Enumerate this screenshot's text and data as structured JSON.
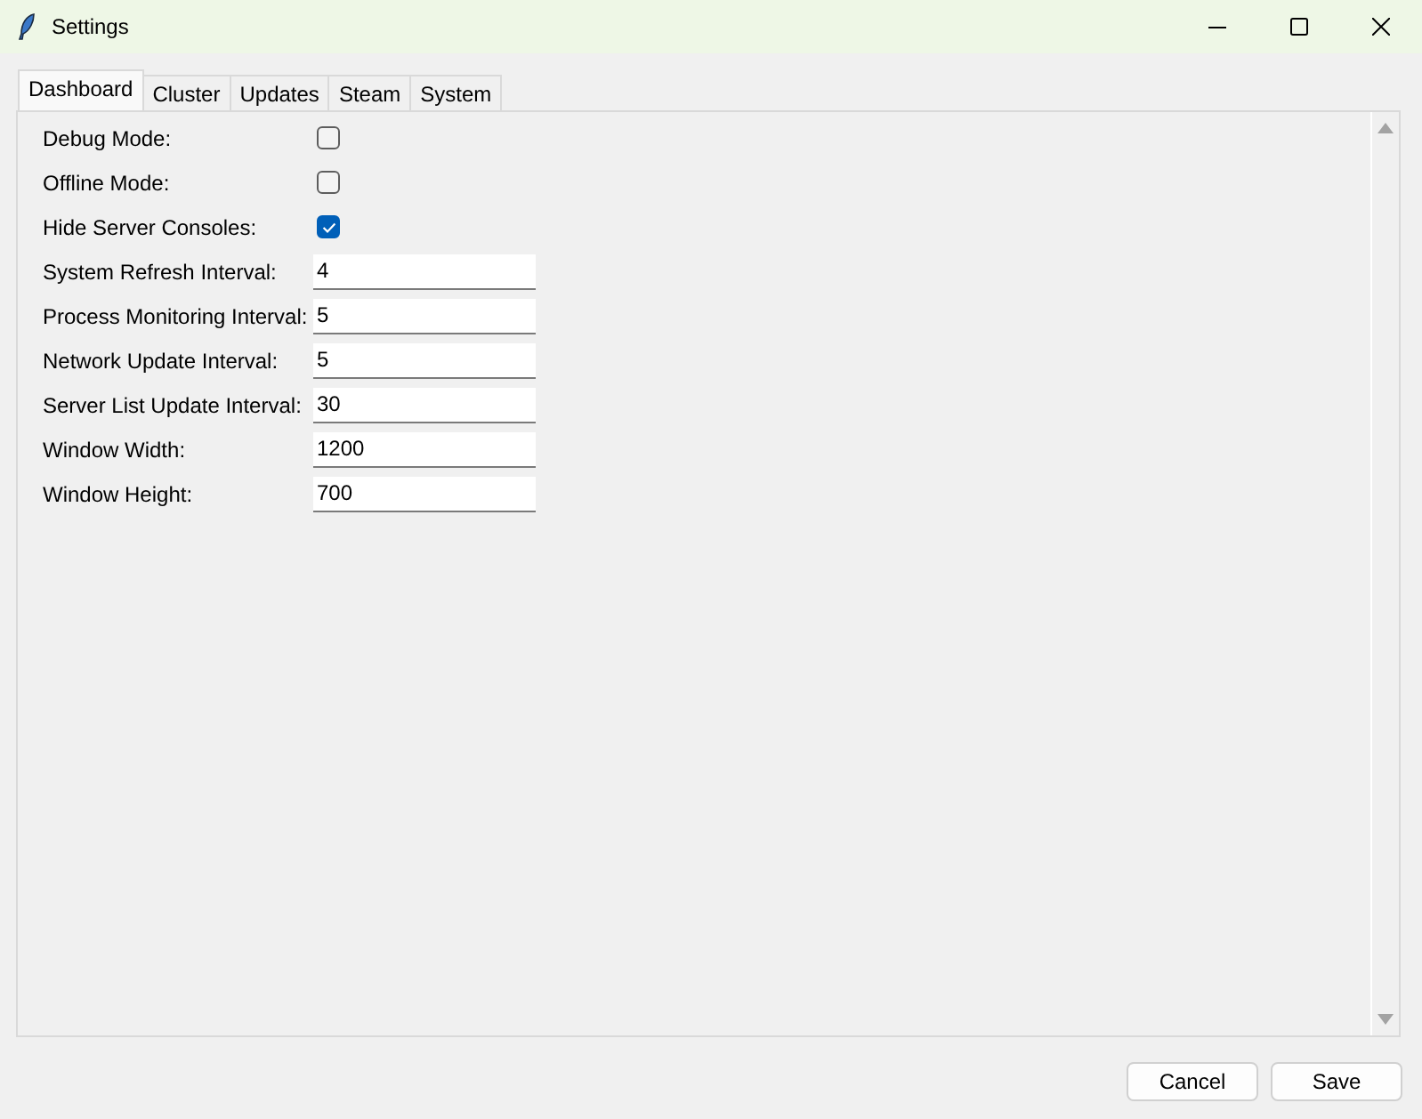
{
  "window": {
    "title": "Settings"
  },
  "tabs": [
    {
      "label": "Dashboard",
      "selected": true
    },
    {
      "label": "Cluster",
      "selected": false
    },
    {
      "label": "Updates",
      "selected": false
    },
    {
      "label": "Steam",
      "selected": false
    },
    {
      "label": "System",
      "selected": false
    }
  ],
  "settings": [
    {
      "kind": "checkbox",
      "label": "Debug Mode:",
      "checked": false
    },
    {
      "kind": "checkbox",
      "label": "Offline Mode:",
      "checked": false
    },
    {
      "kind": "checkbox",
      "label": "Hide Server Consoles:",
      "checked": true
    },
    {
      "kind": "field",
      "label": "System Refresh Interval:",
      "value": "4"
    },
    {
      "kind": "field",
      "label": "Process Monitoring Interval:",
      "value": "5"
    },
    {
      "kind": "field",
      "label": "Network Update Interval:",
      "value": "5"
    },
    {
      "kind": "field",
      "label": "Server List Update Interval:",
      "value": "30"
    },
    {
      "kind": "field",
      "label": "Window Width:",
      "value": "1200"
    },
    {
      "kind": "field",
      "label": "Window Height:",
      "value": "700"
    }
  ],
  "buttons": [
    "Cancel",
    "Save"
  ]
}
